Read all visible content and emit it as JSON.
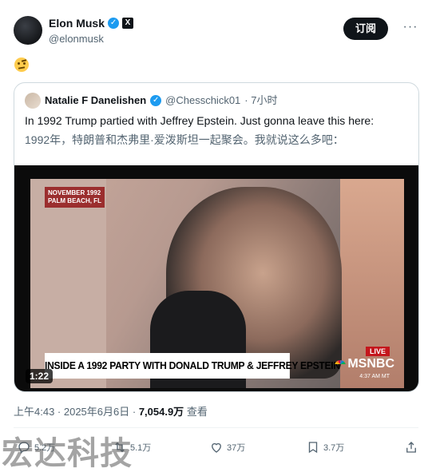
{
  "author": {
    "name": "Elon Musk",
    "handle": "@elonmusk",
    "verified_badge": "check-icon",
    "affiliation_badge": "X"
  },
  "header": {
    "subscribe_label": "订阅",
    "more_label": "···"
  },
  "post": {
    "emoji": "🤨"
  },
  "quoted": {
    "name": "Natalie F Danelishen",
    "handle": "@Chesschick01",
    "time": "· 7小时",
    "text": "In 1992 Trump partied with Jeffrey Epstein. Just gonna leave this here:",
    "translation": "1992年，特朗普和杰弗里·爱泼斯坦一起聚会。我就说这么多吧：",
    "video": {
      "tag_line1": "NOVEMBER 1992",
      "tag_line2": "PALM BEACH, FL",
      "banner": "INSIDE A 1992 PARTY WITH DONALD TRUMP & JEFFREY EPSTEIN",
      "live": "LIVE",
      "network": "MSNBC",
      "clock": "4:37 AM MT",
      "duration": "1:22"
    }
  },
  "meta": {
    "time": "上午4:43 · 2025年6月6日 ·",
    "views": "7,054.9万",
    "views_label": "查看"
  },
  "actions": {
    "replies": "5.2万",
    "reposts": "5.1万",
    "likes": "37万",
    "bookmarks": "3.7万"
  },
  "watermark": "宏达科技",
  "colors": {
    "accent": "#1d9bf0",
    "text": "#0f1419",
    "muted": "#536471",
    "border": "#cfd9de"
  }
}
